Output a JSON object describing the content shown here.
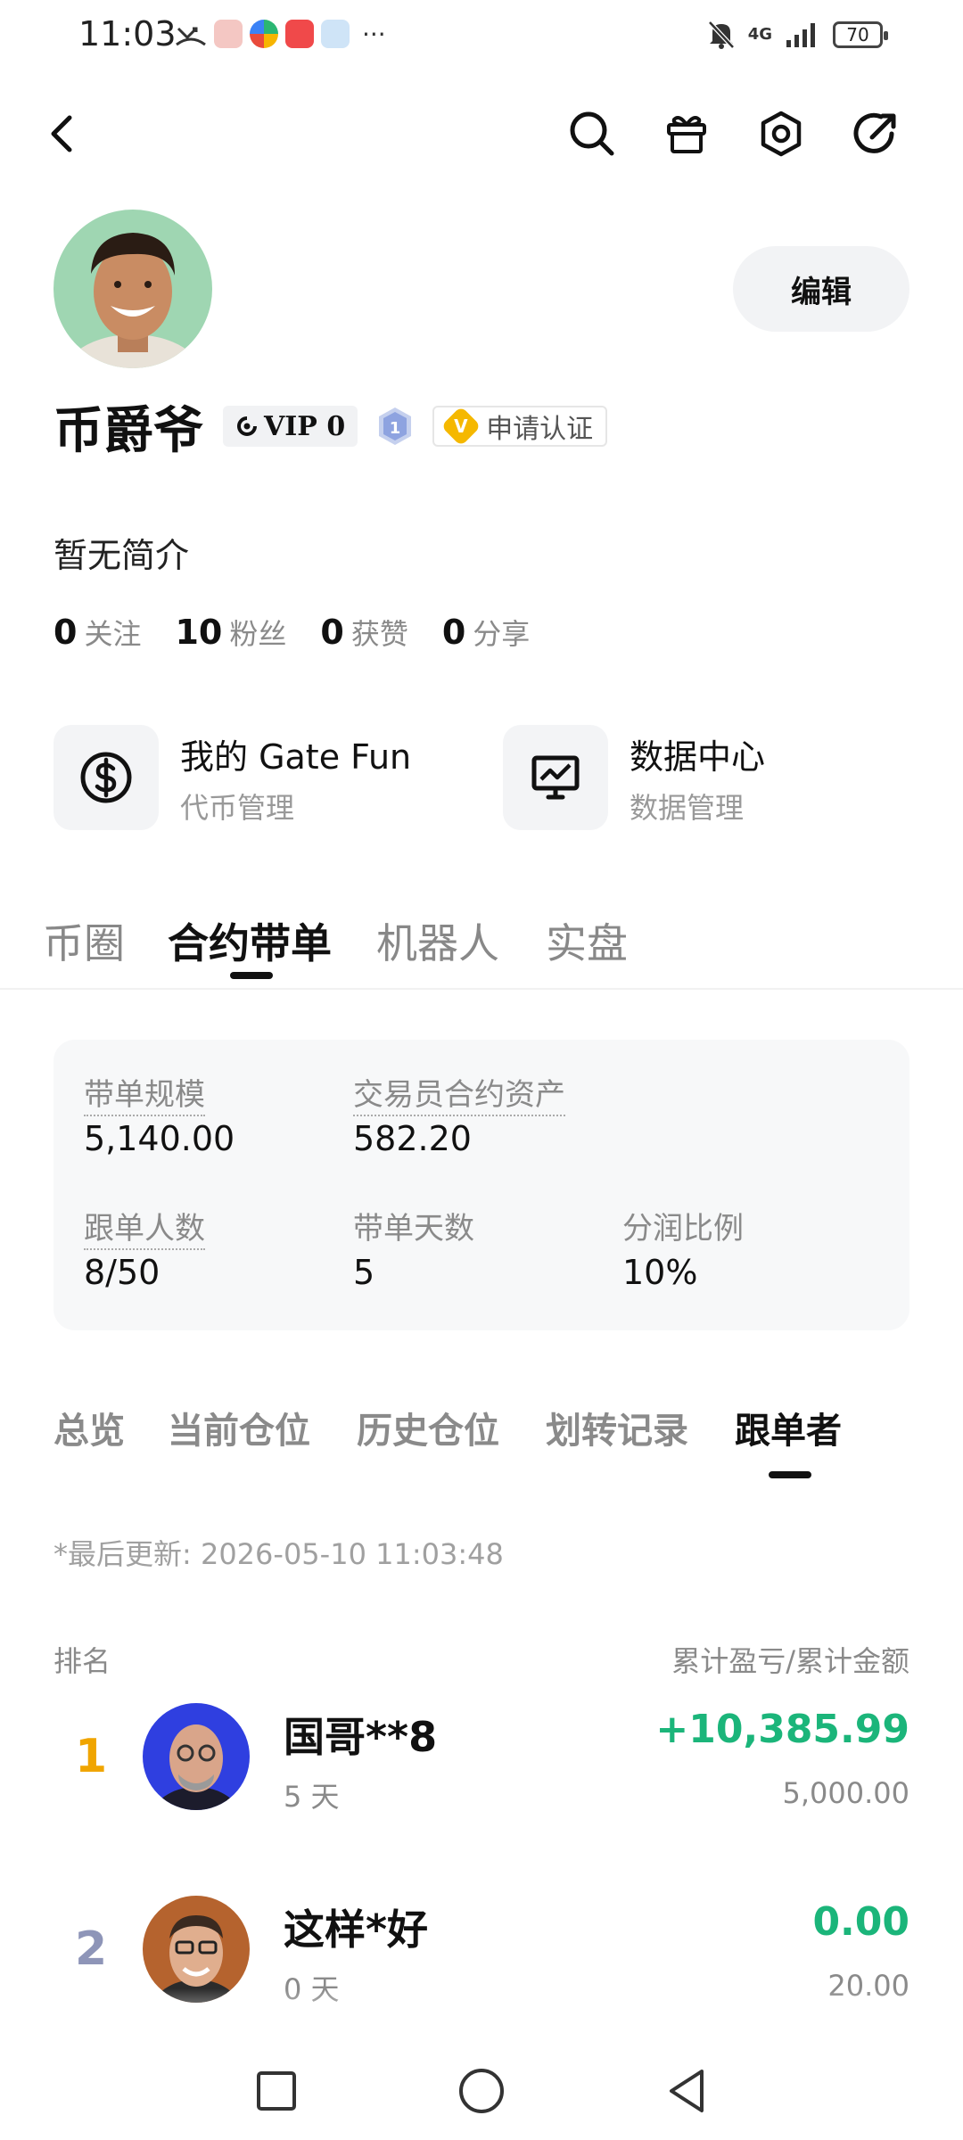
{
  "status_bar": {
    "time": "11:03",
    "more": "···",
    "network": "4G",
    "battery": "70"
  },
  "profile": {
    "username": "币爵爷",
    "vip_label": "VIP 0",
    "level": "1",
    "verify_icon_letter": "V",
    "verify_label": "申请认证",
    "edit_label": "编辑",
    "bio": "暂无简介",
    "stats": [
      {
        "value": "0",
        "label": "关注"
      },
      {
        "value": "10",
        "label": "粉丝"
      },
      {
        "value": "0",
        "label": "获赞"
      },
      {
        "value": "0",
        "label": "分享"
      }
    ]
  },
  "feature_cards": [
    {
      "title": "我的 Gate Fun",
      "subtitle": "代币管理",
      "icon": "dollar-coin-icon"
    },
    {
      "title": "数据中心",
      "subtitle": "数据管理",
      "icon": "chart-monitor-icon"
    }
  ],
  "main_tabs": [
    {
      "label": "币圈"
    },
    {
      "label": "合约带单",
      "active": true
    },
    {
      "label": "机器人"
    },
    {
      "label": "实盘"
    }
  ],
  "summary": [
    {
      "label": "带单规模",
      "value": "5,140.00"
    },
    {
      "label": "交易员合约资产",
      "value": "582.20"
    },
    {
      "label": "跟单人数",
      "value": "8/50"
    },
    {
      "label": "带单天数",
      "value": "5"
    },
    {
      "label": "分润比例",
      "value": "10%"
    }
  ],
  "sub_tabs": [
    {
      "label": "总览"
    },
    {
      "label": "当前仓位"
    },
    {
      "label": "历史仓位"
    },
    {
      "label": "划转记录"
    },
    {
      "label": "跟单者",
      "active": true
    }
  ],
  "followers": {
    "last_updated": "*最后更新: 2026-05-10 11:03:48",
    "col_rank": "排名",
    "col_pnl": "累计盈亏/累计金额",
    "rows": [
      {
        "rank": "1",
        "name": "国哥**8",
        "days": "5 天",
        "pnl": "+10,385.99",
        "amount": "5,000.00"
      },
      {
        "rank": "2",
        "name": "这样*好",
        "days": "0 天",
        "pnl": "0.00",
        "amount": "20.00"
      }
    ]
  },
  "colors": {
    "profit_green": "#1bb57a",
    "rank_gold": "#f0a500",
    "rank_silver": "#8e95b8",
    "verify_yellow": "#f5b800"
  }
}
